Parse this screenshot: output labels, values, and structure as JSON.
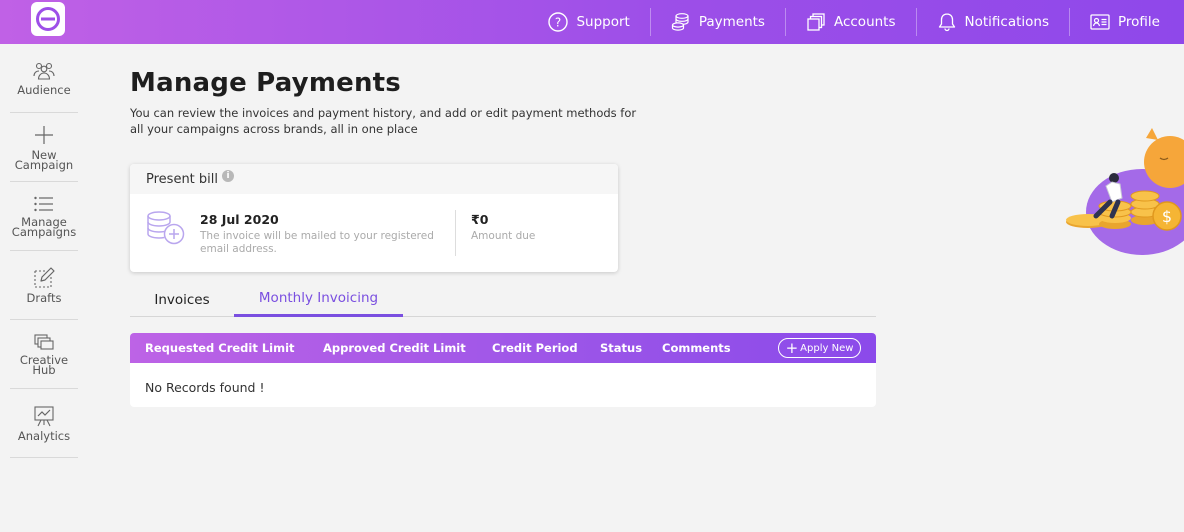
{
  "nav": {
    "support": "Support",
    "payments": "Payments",
    "accounts": "Accounts",
    "notifications": "Notifications",
    "profile": "Profile"
  },
  "sidebar": {
    "items": [
      {
        "label": "Audience",
        "icon": "audience-icon"
      },
      {
        "label": "New Campaign",
        "icon": "plus-icon"
      },
      {
        "label": "Manage Campaigns",
        "icon": "list-icon"
      },
      {
        "label": "Drafts",
        "icon": "edit-icon"
      },
      {
        "label": "Creative Hub",
        "icon": "gallery-icon"
      },
      {
        "label": "Analytics",
        "icon": "chart-board-icon"
      }
    ]
  },
  "page": {
    "title": "Manage Payments",
    "subtitle": "You can review the invoices and payment history, and add or edit payment methods for all your campaigns across brands, all in one place"
  },
  "bill": {
    "header": "Present bill",
    "date": "28 Jul 2020",
    "note": "The invoice will be mailed to your registered email address.",
    "amount": "₹0",
    "amount_label": "Amount due"
  },
  "tabs": {
    "invoices": "Invoices",
    "monthly": "Monthly Invoicing",
    "active": "Monthly Invoicing"
  },
  "table": {
    "columns": [
      "Requested Credit Limit",
      "Approved Credit Limit",
      "Credit Period",
      "Status",
      "Comments"
    ],
    "apply_label": "Apply New",
    "empty_text": "No Records found !"
  },
  "colors": {
    "accent": "#7a4fe0",
    "header_start": "#c061e6",
    "header_end": "#8f48ea"
  }
}
